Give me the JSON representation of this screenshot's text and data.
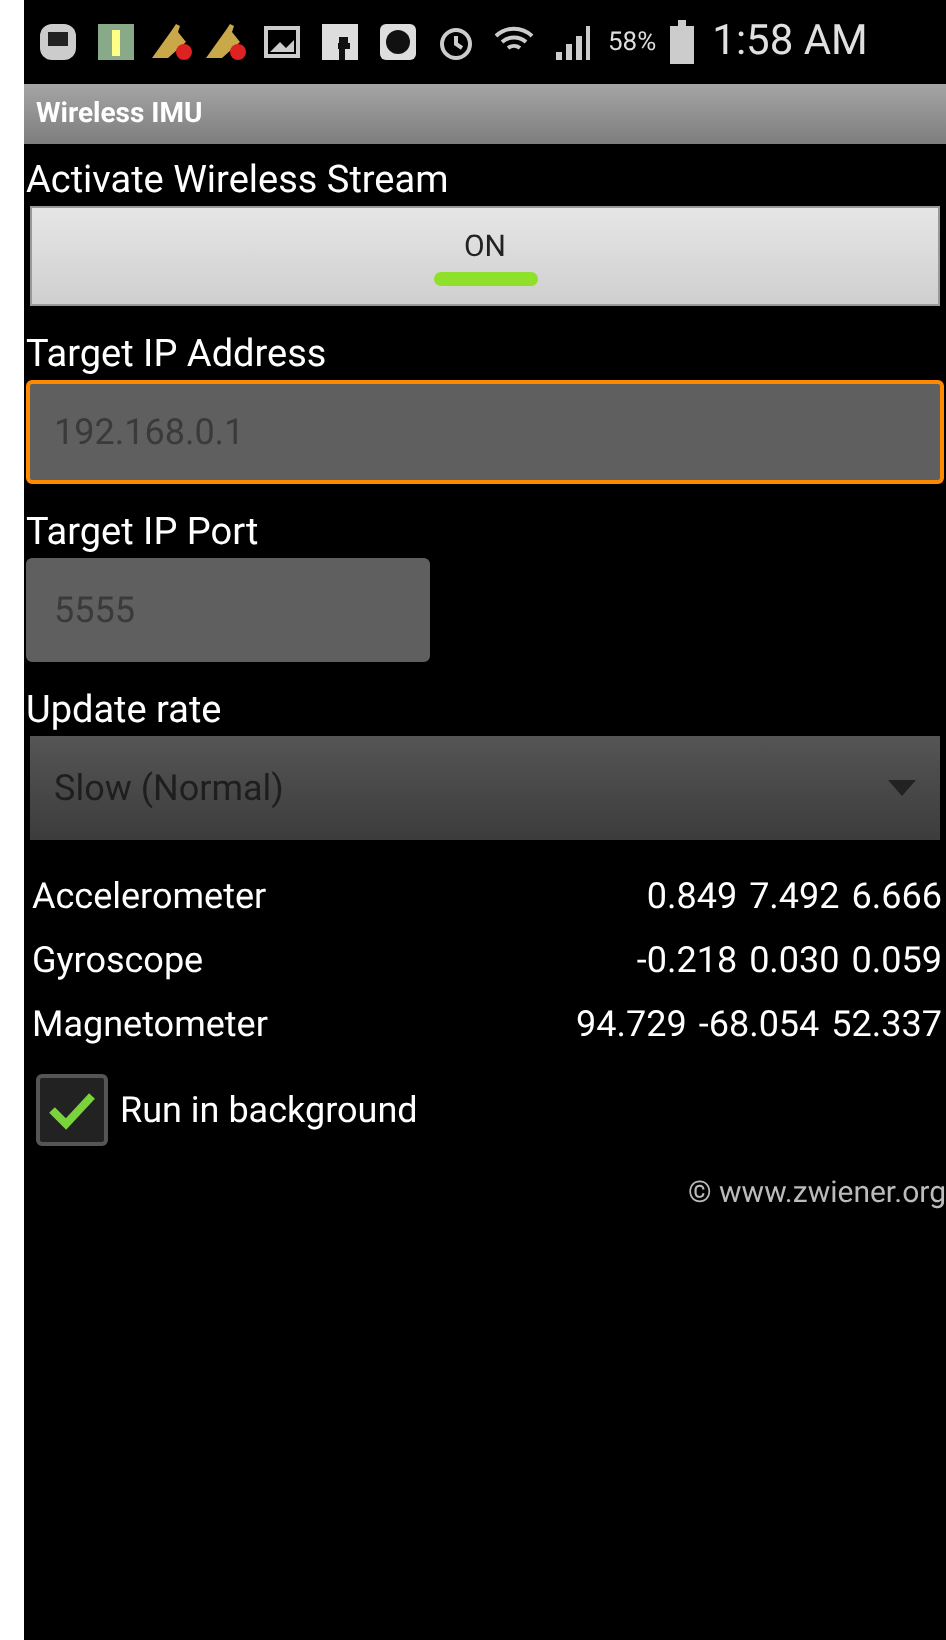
{
  "status_bar": {
    "battery": "58%",
    "time": "1:58 AM"
  },
  "window": {
    "title": "Wireless IMU"
  },
  "stream": {
    "label": "Activate Wireless Stream",
    "toggle": {
      "text": "ON",
      "on": true
    }
  },
  "ip": {
    "label": "Target IP Address",
    "placeholder": "192.168.0.1",
    "focused": true
  },
  "port": {
    "label": "Target IP Port",
    "placeholder": "5555",
    "focused": false
  },
  "rate": {
    "label": "Update rate",
    "value": "Slow (Normal)"
  },
  "sensors": [
    {
      "name": "Accelerometer",
      "values": [
        "0.849",
        "7.492",
        "6.666"
      ]
    },
    {
      "name": "Gyroscope",
      "values": [
        "-0.218",
        "0.030",
        "0.059"
      ]
    },
    {
      "name": "Magnetometer",
      "values": [
        "94.729",
        "-68.054",
        "52.337"
      ]
    }
  ],
  "background": {
    "label": "Run in background",
    "checked": true
  },
  "footer": "© www.zwiener.org"
}
